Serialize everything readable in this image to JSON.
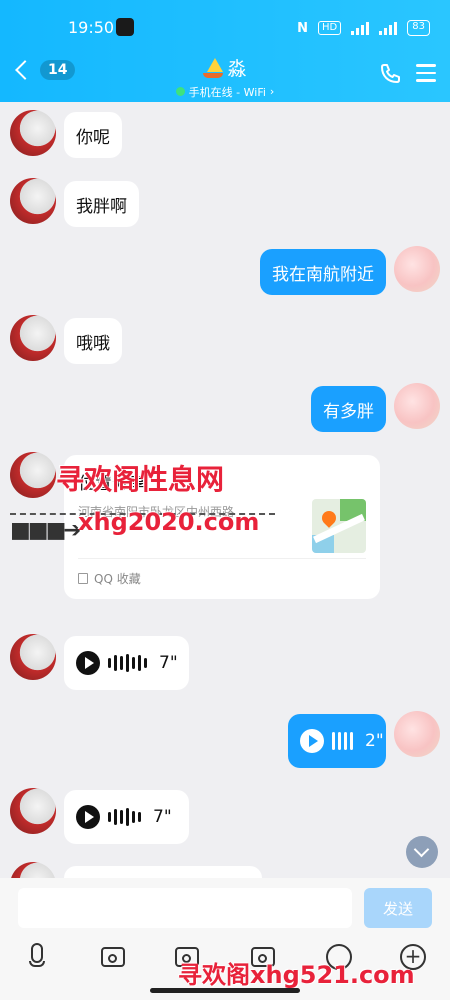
{
  "status_bar": {
    "time": "19:50",
    "battery": "83"
  },
  "header": {
    "back_count": "14",
    "title": "淼",
    "online_status": "手机在线 - WiFi",
    "online_chevron": "›"
  },
  "messages": [
    {
      "side": "in",
      "type": "text",
      "text": "你呢"
    },
    {
      "side": "in",
      "type": "text",
      "text": "我胖啊"
    },
    {
      "side": "out",
      "type": "text",
      "text": "我在南航附近"
    },
    {
      "side": "in",
      "type": "text",
      "text": "哦哦"
    },
    {
      "side": "out",
      "type": "text",
      "text": "有多胖"
    },
    {
      "side": "in",
      "type": "location",
      "title": "位置分享",
      "address": "河南省南阳市卧龙区中州西路",
      "source": "QQ 收藏"
    },
    {
      "side": "in",
      "type": "voice",
      "duration": "7\""
    },
    {
      "side": "out",
      "type": "voice",
      "duration": "2\""
    },
    {
      "side": "in",
      "type": "voice",
      "duration": "7\""
    }
  ],
  "watermarks": {
    "top": "寻欢阁性息网",
    "mid": "xhg2020.com",
    "bottom": "寻欢阁xhg521.com"
  },
  "input": {
    "value": "",
    "send_label": "发送"
  },
  "icons": [
    "mic-icon",
    "image-icon",
    "camera-icon",
    "red-packet-icon",
    "emoji-icon",
    "plus-icon"
  ],
  "colors": {
    "header": "#1cbcff",
    "bubble_out": "#1aa0ff",
    "send_disabled": "#a9d6fb"
  }
}
